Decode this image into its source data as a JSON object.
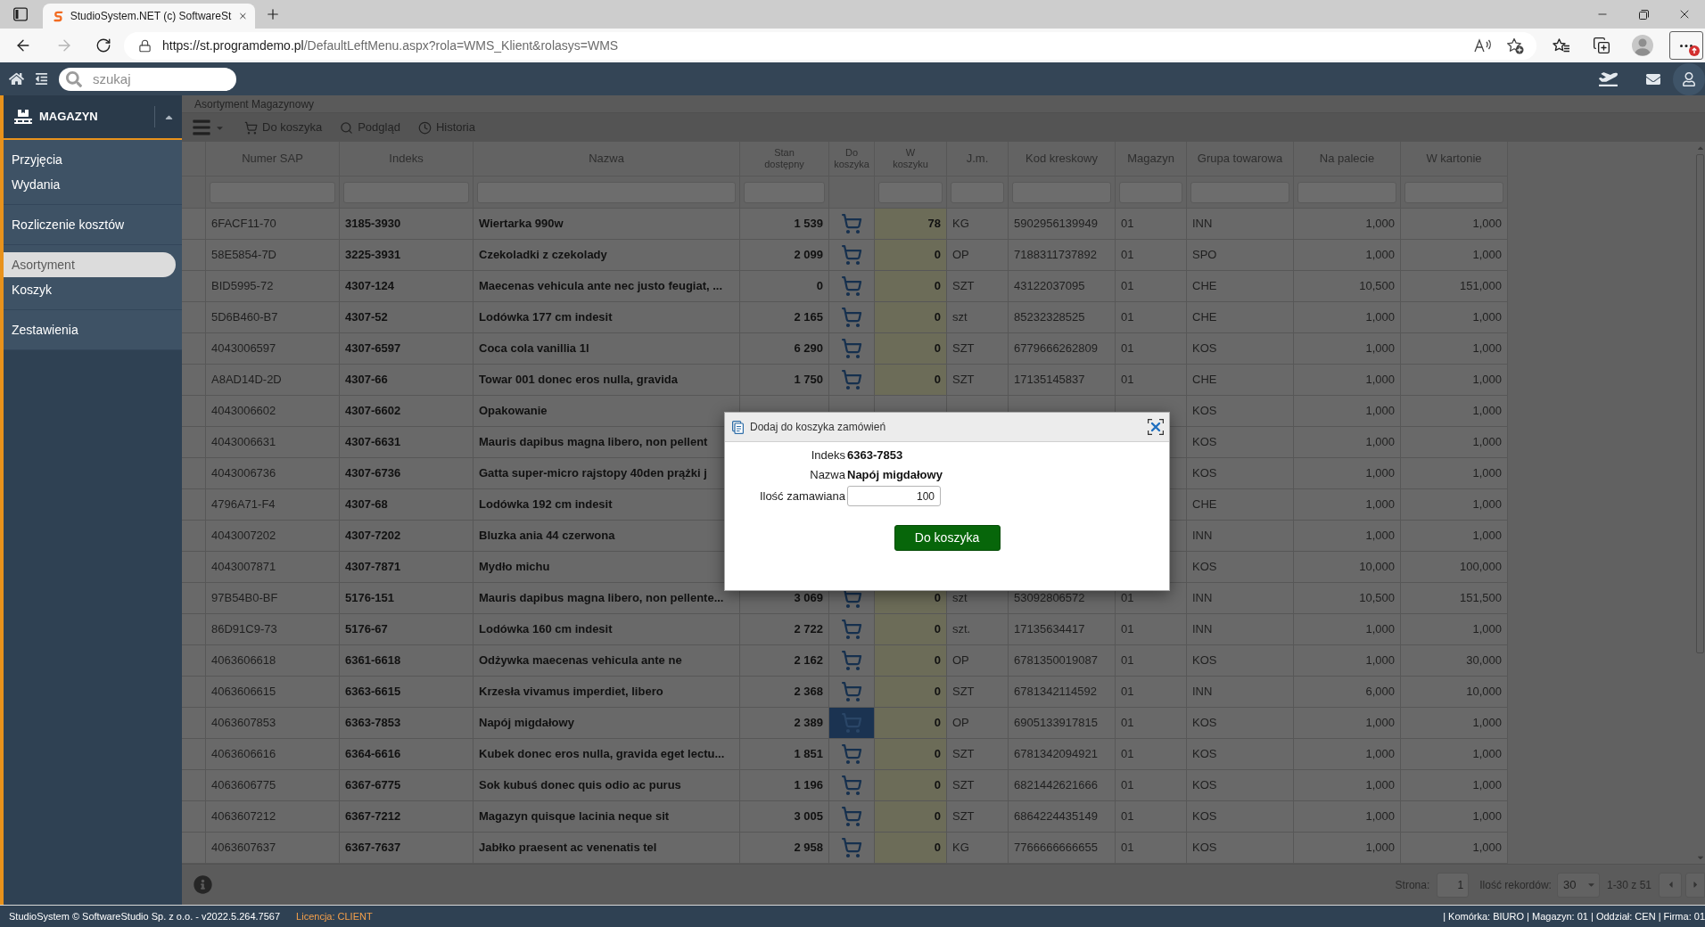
{
  "browser": {
    "tab_title": "StudioSystem.NET (c) SoftwareSt",
    "url": {
      "host": "https://st.programdemo.pl",
      "path": "/DefaultLeftMenu.aspx?rola=WMS_Klient&rolasys=WMS"
    }
  },
  "app_header": {
    "search": {
      "placeholder": "szukaj"
    }
  },
  "sidebar": {
    "module": "MAGAZYN",
    "groups": [
      {
        "items": [
          {
            "label": "Przyjęcia",
            "selected": false
          },
          {
            "label": "Wydania",
            "selected": false
          }
        ]
      },
      {
        "items": [
          {
            "label": "Rozliczenie kosztów",
            "selected": false
          }
        ]
      },
      {
        "items": [
          {
            "label": "Asortyment",
            "selected": true
          },
          {
            "label": "Koszyk",
            "selected": false
          }
        ]
      },
      {
        "items": [
          {
            "label": "Zestawienia",
            "selected": false
          }
        ]
      }
    ]
  },
  "page": {
    "title": "Asortyment Magazynowy",
    "toolbar": [
      "Do koszyka",
      "Podgląd",
      "Historia"
    ]
  },
  "table": {
    "columns": [
      {
        "label": "Numer SAP",
        "kind": "text"
      },
      {
        "label": "Indeks",
        "kind": "bold"
      },
      {
        "label": "Nazwa",
        "kind": "bold"
      },
      {
        "label": "Stan dostępny",
        "kind": "stock"
      },
      {
        "label": "Do koszyka",
        "kind": "cart"
      },
      {
        "label": "W koszyku",
        "kind": "basket"
      },
      {
        "label": "J.m.",
        "kind": "text"
      },
      {
        "label": "Kod kreskowy",
        "kind": "text"
      },
      {
        "label": "Magazyn",
        "kind": "text"
      },
      {
        "label": "Grupa towarowa",
        "kind": "text"
      },
      {
        "label": "Na palecie",
        "kind": "number"
      },
      {
        "label": "W kartonie",
        "kind": "number"
      }
    ],
    "rows": [
      {
        "sap": "6FACF11-70",
        "indeks": "3185-3930",
        "nazwa": "Wiertarka 990w",
        "stan": "1 539",
        "cart": {
          "selected": false
        },
        "w_koszyku": "78",
        "jm": "KG",
        "kod": "5902956139949",
        "magazyn": "01",
        "grupa": "INN",
        "na_palecie": "1,000",
        "w_kartonie": "1,000"
      },
      {
        "sap": "58E5854-7D",
        "indeks": "3225-3931",
        "nazwa": "Czekoladki z czekolady",
        "stan": "2 099",
        "cart": {
          "selected": false
        },
        "w_koszyku": "0",
        "jm": "OP",
        "kod": "7188311737892",
        "magazyn": "01",
        "grupa": "SPO",
        "na_palecie": "1,000",
        "w_kartonie": "1,000"
      },
      {
        "sap": "BID5995-72",
        "indeks": "4307-124",
        "nazwa": "Maecenas vehicula ante nec justo feugiat, ...",
        "stan": "0",
        "cart": {
          "selected": false
        },
        "w_koszyku": "0",
        "jm": "SZT",
        "kod": "43122037095",
        "magazyn": "01",
        "grupa": "CHE",
        "na_palecie": "10,500",
        "w_kartonie": "151,000"
      },
      {
        "sap": "5D6B460-B7",
        "indeks": "4307-52",
        "nazwa": "Lodówka 177 cm indesit",
        "stan": "2 165",
        "cart": {
          "selected": false
        },
        "w_koszyku": "0",
        "jm": "szt",
        "kod": "85232328525",
        "magazyn": "01",
        "grupa": "CHE",
        "na_palecie": "1,000",
        "w_kartonie": "1,000"
      },
      {
        "sap": "4043006597",
        "indeks": "4307-6597",
        "nazwa": "Coca cola vanillia 1l",
        "stan": "6 290",
        "cart": {
          "selected": false
        },
        "w_koszyku": "0",
        "jm": "SZT",
        "kod": "6779666262809",
        "magazyn": "01",
        "grupa": "KOS",
        "na_palecie": "1,000",
        "w_kartonie": "1,000"
      },
      {
        "sap": "A8AD14D-2D",
        "indeks": "4307-66",
        "nazwa": "Towar 001 donec eros nulla, gravida",
        "stan": "1 750",
        "cart": {
          "selected": false
        },
        "w_koszyku": "0",
        "jm": "SZT",
        "kod": "17135145837",
        "magazyn": "01",
        "grupa": "CHE",
        "na_palecie": "1,000",
        "w_kartonie": "1,000"
      },
      {
        "sap": "4043006602",
        "indeks": "4307-6602",
        "nazwa": "Opakowanie",
        "grupa": "KOS",
        "na_palecie": "1,000",
        "w_kartonie": "1,000"
      },
      {
        "sap": "4043006631",
        "indeks": "4307-6631",
        "nazwa": "Mauris dapibus magna libero, non pellent",
        "grupa": "KOS",
        "na_palecie": "1,000",
        "w_kartonie": "1,000"
      },
      {
        "sap": "4043006736",
        "indeks": "4307-6736",
        "nazwa": "Gatta super-micro rajstopy 40den prążki j",
        "grupa": "KOS",
        "na_palecie": "1,000",
        "w_kartonie": "1,000"
      },
      {
        "sap": "4796A71-F4",
        "indeks": "4307-68",
        "nazwa": "Lodówka 192 cm indesit",
        "grupa": "CHE",
        "na_palecie": "1,000",
        "w_kartonie": "1,000"
      },
      {
        "sap": "4043007202",
        "indeks": "4307-7202",
        "nazwa": "Bluzka ania 44 czerwona",
        "grupa": "INN",
        "na_palecie": "1,000",
        "w_kartonie": "1,000"
      },
      {
        "sap": "4043007871",
        "indeks": "4307-7871",
        "nazwa": "Mydło michu",
        "grupa": "KOS",
        "na_palecie": "10,000",
        "w_kartonie": "100,000"
      },
      {
        "sap": "97B54B0-BF",
        "indeks": "5176-151",
        "nazwa": "Mauris dapibus magna libero, non pellente...",
        "stan": "3 069",
        "cart": {
          "selected": false
        },
        "w_koszyku": "0",
        "jm": "szt",
        "kod": "53092806572",
        "magazyn": "01",
        "grupa": "INN",
        "na_palecie": "10,500",
        "w_kartonie": "151,500"
      },
      {
        "sap": "86D91C9-73",
        "indeks": "5176-67",
        "nazwa": "Lodówka 160 cm indesit",
        "stan": "2 722",
        "cart": {
          "selected": false
        },
        "w_koszyku": "0",
        "jm": "szt.",
        "kod": "17135634417",
        "magazyn": "01",
        "grupa": "INN",
        "na_palecie": "1,000",
        "w_kartonie": "1,000"
      },
      {
        "sap": "4063606618",
        "indeks": "6361-6618",
        "nazwa": "Odżywka maecenas vehicula ante ne",
        "stan": "2 162",
        "cart": {
          "selected": false
        },
        "w_koszyku": "0",
        "jm": "OP",
        "kod": "6781350019087",
        "magazyn": "01",
        "grupa": "KOS",
        "na_palecie": "1,000",
        "w_kartonie": "30,000"
      },
      {
        "sap": "4063606615",
        "indeks": "6363-6615",
        "nazwa": "Krzesła vivamus imperdiet, libero",
        "stan": "2 368",
        "cart": {
          "selected": false
        },
        "w_koszyku": "0",
        "jm": "SZT",
        "kod": "6781342114592",
        "magazyn": "01",
        "grupa": "INN",
        "na_palecie": "6,000",
        "w_kartonie": "10,000"
      },
      {
        "sap": "4063607853",
        "indeks": "6363-7853",
        "nazwa": "Napój migdałowy",
        "stan": "2 389",
        "cart": {
          "selected": true
        },
        "w_koszyku": "0",
        "jm": "OP",
        "kod": "6905133917815",
        "magazyn": "01",
        "grupa": "KOS",
        "na_palecie": "1,000",
        "w_kartonie": "1,000"
      },
      {
        "sap": "4063606616",
        "indeks": "6364-6616",
        "nazwa": "Kubek donec eros nulla, gravida eget lectu...",
        "stan": "1 851",
        "cart": {
          "selected": false
        },
        "w_koszyku": "0",
        "jm": "SZT",
        "kod": "6781342094921",
        "magazyn": "01",
        "grupa": "KOS",
        "na_palecie": "1,000",
        "w_kartonie": "1,000"
      },
      {
        "sap": "4063606775",
        "indeks": "6367-6775",
        "nazwa": "Sok kubuś donec quis odio ac purus",
        "stan": "1 196",
        "cart": {
          "selected": false
        },
        "w_koszyku": "0",
        "jm": "SZT",
        "kod": "6821442621666",
        "magazyn": "01",
        "grupa": "KOS",
        "na_palecie": "1,000",
        "w_kartonie": "1,000"
      },
      {
        "sap": "4063607212",
        "indeks": "6367-7212",
        "nazwa": "Magazyn quisque lacinia neque sit",
        "stan": "3 005",
        "cart": {
          "selected": false
        },
        "w_koszyku": "0",
        "jm": "SZT",
        "kod": "6864224435149",
        "magazyn": "01",
        "grupa": "KOS",
        "na_palecie": "1,000",
        "w_kartonie": "1,000"
      },
      {
        "sap": "4063607637",
        "indeks": "6367-7637",
        "nazwa": "Jabłko praesent ac venenatis tel",
        "stan": "2 958",
        "cart": {
          "selected": false
        },
        "w_koszyku": "0",
        "jm": "KG",
        "kod": "7766666666655",
        "magazyn": "01",
        "grupa": "KOS",
        "na_palecie": "1,000",
        "w_kartonie": "1,000"
      }
    ]
  },
  "pager": {
    "page_label": "Strona:",
    "page": "1",
    "size_label": "Ilość rekordów:",
    "size": "30",
    "range": "1-30 z 51"
  },
  "dialog": {
    "title": "Dodaj do koszyka zamówień",
    "fields": [
      {
        "label": "Indeks",
        "value": "6363-7853",
        "kind": "text"
      },
      {
        "label": "Nazwa",
        "value": "Napój migdałowy",
        "kind": "text"
      },
      {
        "label": "Ilość zamawiana",
        "value": "100",
        "kind": "input"
      }
    ],
    "button": "Do koszyka"
  },
  "footer": {
    "copyright": "StudioSystem © SoftwareStudio Sp. z o.o. - v2022.5.264.7567",
    "license": "Licencja: CLIENT",
    "context": "| Komórka: BIURO | Magazyn: 01 | Oddział: CEN | Firma: 01"
  }
}
